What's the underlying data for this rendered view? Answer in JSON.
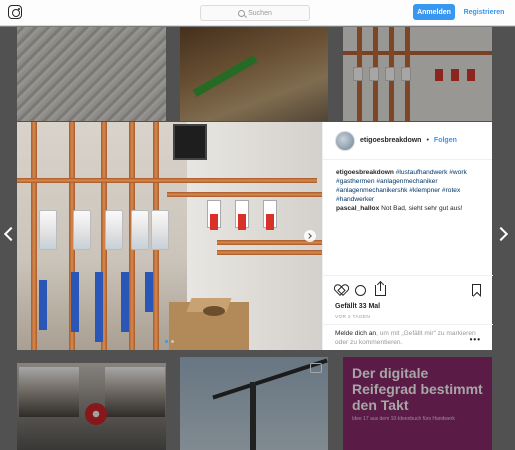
{
  "header": {
    "search_placeholder": "Suchen",
    "login_label": "Anmelden",
    "register_label": "Registrieren"
  },
  "ad_tile": {
    "title": "Der digitale Reifegrad bestimmt den Takt",
    "subtitle": "Idee 17 aus dem 10-Ideenbuch fürs Handwerk"
  },
  "post": {
    "username": "etigoesbreakdown",
    "separator": "•",
    "follow_label": "Folgen",
    "caption_user": "etigoesbreakdown",
    "caption_tags": "#lustaufhandwerk #work #gasthermen #anlagenmechaniker #anlagenmechanikershk #klempner #rotex #handwerker",
    "comment_user": "pascal_hallox",
    "comment_text": "Not Bad, sieht sehr gut aus!",
    "likes": "Gefällt 33 Mal",
    "date": "VOR 2 TAGEN",
    "login_text": "Melde dich an",
    "login_suffix": ", um mit „Gefällt mir“ zu markieren oder zu kommentieren.",
    "more": "•••"
  }
}
